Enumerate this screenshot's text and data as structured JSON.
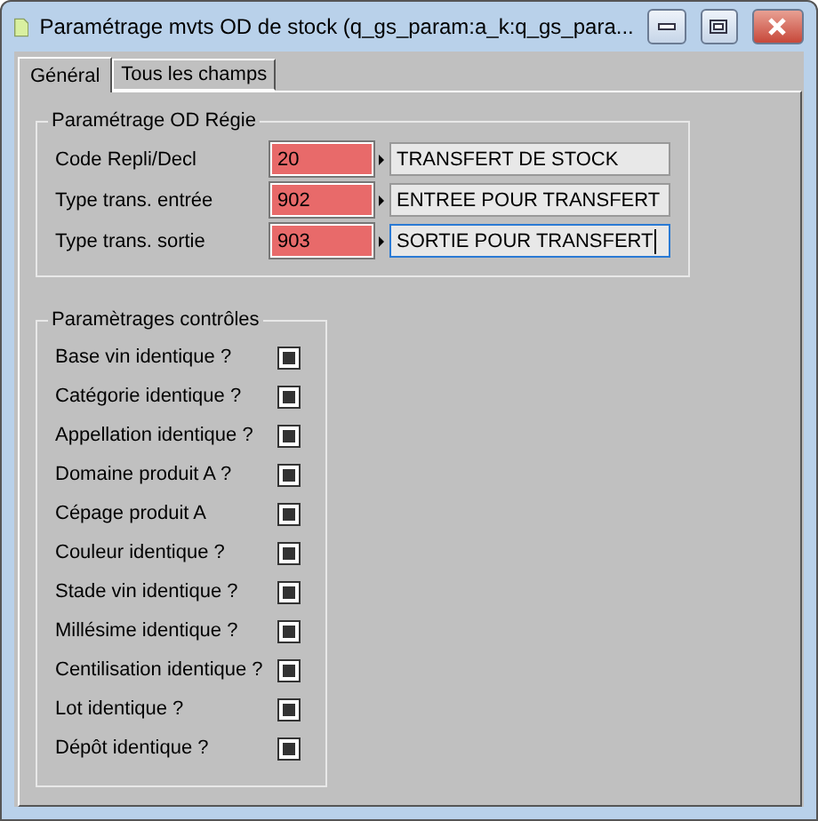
{
  "window": {
    "title": "Paramétrage mvts OD de stock (q_gs_param:a_k:q_gs_para..."
  },
  "tabs": [
    {
      "label": "Général",
      "selected": true
    },
    {
      "label": "Tous les champs",
      "selected": false
    }
  ],
  "od_regie": {
    "title": "Paramétrage OD Régie",
    "rows": [
      {
        "label": "Code Repli/Decl",
        "code": "20",
        "text": "TRANSFERT DE STOCK",
        "focused": false
      },
      {
        "label": "Type trans. entrée",
        "code": "902",
        "text": "ENTREE POUR TRANSFERT",
        "focused": false
      },
      {
        "label": "Type trans. sortie",
        "code": "903",
        "text": "SORTIE POUR TRANSFERT",
        "focused": true
      }
    ]
  },
  "controles": {
    "title": "Paramètrages contrôles",
    "items": [
      {
        "label": "Base vin identique ?",
        "checked": true
      },
      {
        "label": "Catégorie identique ?",
        "checked": true
      },
      {
        "label": "Appellation identique ?",
        "checked": true
      },
      {
        "label": "Domaine produit A ?",
        "checked": true
      },
      {
        "label": "Cépage produit A",
        "checked": true
      },
      {
        "label": "Couleur identique ?",
        "checked": true
      },
      {
        "label": "Stade vin identique ?",
        "checked": true
      },
      {
        "label": "Millésime identique ?",
        "checked": true
      },
      {
        "label": "Centilisation identique ?",
        "checked": true
      },
      {
        "label": "Lot identique ?",
        "checked": true
      },
      {
        "label": "Dépôt identique ?",
        "checked": true
      }
    ]
  }
}
